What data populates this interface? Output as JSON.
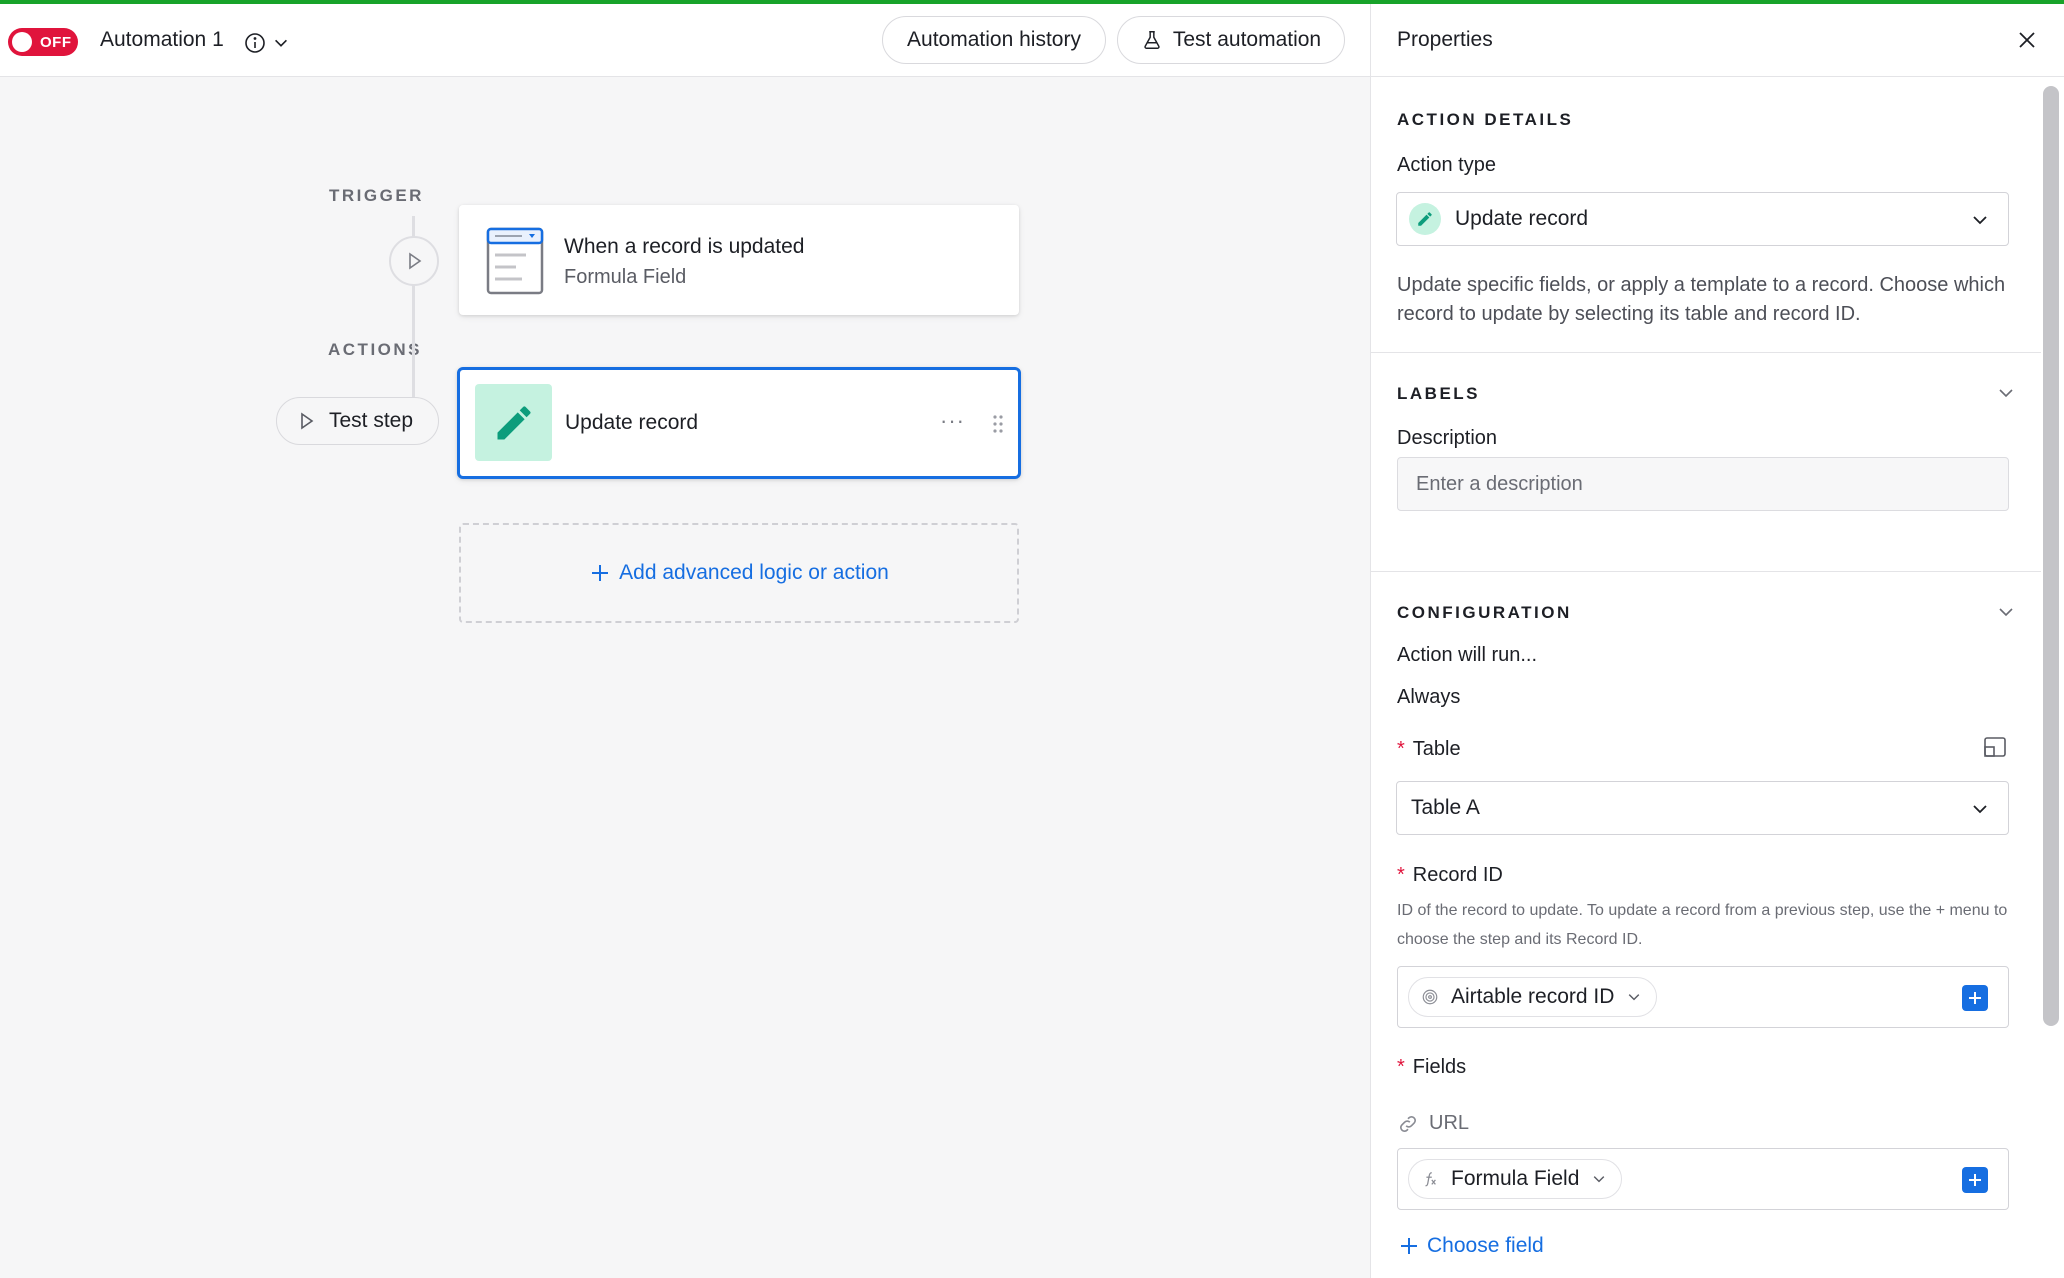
{
  "topbar": {
    "toggle_label": "OFF",
    "automation_name": "Automation 1",
    "history_button": "Automation history",
    "test_button": "Test automation"
  },
  "canvas": {
    "trigger_label": "TRIGGER",
    "actions_label": "ACTIONS",
    "trigger_card": {
      "title": "When a record is updated",
      "subtitle": "Formula Field"
    },
    "test_step_label": "Test step",
    "action_card": {
      "title": "Update record",
      "more": "···"
    },
    "add_button": "Add advanced logic or action"
  },
  "panel": {
    "title": "Properties",
    "action_details": {
      "section_label": "ACTION DETAILS",
      "action_type_label": "Action type",
      "action_type_value": "Update record",
      "description": "Update specific fields, or apply a template to a record. Choose which record to update by selecting its table and record ID."
    },
    "labels": {
      "section_label": "LABELS",
      "description_label": "Description",
      "description_placeholder": "Enter a description"
    },
    "configuration": {
      "section_label": "CONFIGURATION",
      "run_label": "Action will run...",
      "run_value": "Always",
      "table_label": "Table",
      "table_value": "Table A",
      "record_id_label": "Record ID",
      "record_id_help": "ID of the record to update. To update a record from a previous step, use the + menu to choose the step and its Record ID.",
      "record_id_token": "Airtable record ID",
      "fields_label": "Fields",
      "url_field_label": "URL",
      "url_token": "Formula Field",
      "choose_field": "Choose field"
    }
  },
  "colors": {
    "accent_blue": "#166ee1",
    "toggle_red": "#e0143c",
    "action_icon_bg": "#c5f2e0",
    "top_line_green": "#18a32a"
  }
}
